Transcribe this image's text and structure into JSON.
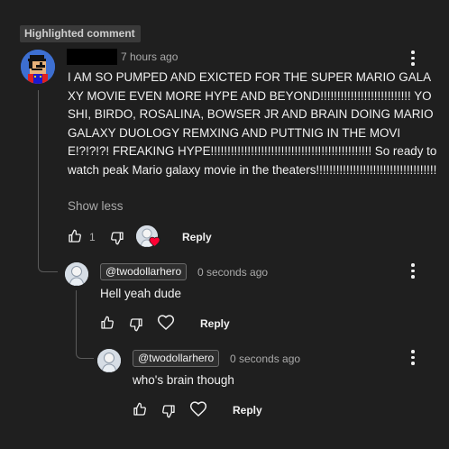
{
  "badge": "Highlighted comment",
  "main_comment": {
    "author_redacted": true,
    "time": "7 hours ago",
    "text": "I AM SO PUMPED AND EXICTED FOR THE SUPER MARIO GALAXY MOVIE EVEN MORE HYPE AND BEYOND!!!!!!!!!!!!!!!!!!!!!!!!!!! YOSHI, BIRDO, ROSALINA, BOWSER JR AND BRAIN DOING MARIO GALAXY DUOLOGY REMXING AND PUTTNIG IN THE MOVIE!?!?!?! FREAKING HYPE!!!!!!!!!!!!!!!!!!!!!!!!!!!!!!!!!!!!!!!!!!!!!!!! So ready to watch peak Mario galaxy movie in the theaters!!!!!!!!!!!!!!!!!!!!!!!!!!!!!!!!!!!!",
    "show_less": "Show less",
    "like_count": "1",
    "reply_label": "Reply",
    "icons": [
      "mario-avatar-icon",
      "thumbs-up-icon",
      "thumbs-down-icon",
      "heart-icon",
      "more-vert-icon"
    ],
    "creator_heart_color": "#ff0033"
  },
  "replies": [
    {
      "mention": "@twodollarhero",
      "time": "0 seconds ago",
      "text": "Hell yeah dude",
      "reply_label": "Reply"
    },
    {
      "mention": "@twodollarhero",
      "time": "0 seconds ago",
      "text": "who's brain though",
      "reply_label": "Reply"
    }
  ],
  "colors": {
    "background": "#1f1f1f",
    "text": "#f1f1f1",
    "muted": "#aaaaaa"
  }
}
